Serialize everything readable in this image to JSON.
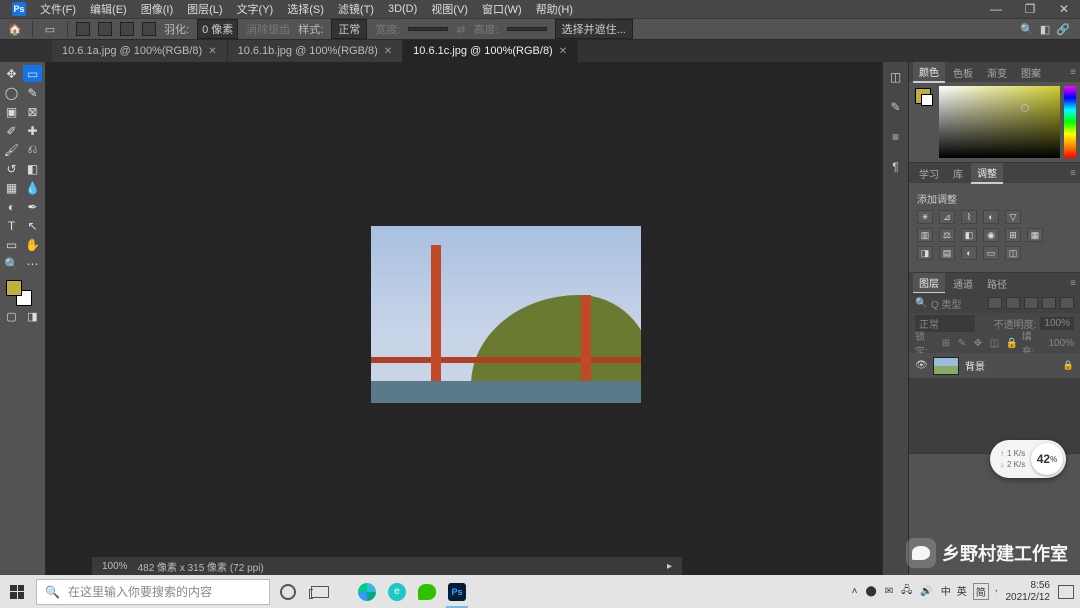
{
  "menubar": {
    "items": [
      "文件(F)",
      "编辑(E)",
      "图像(I)",
      "图层(L)",
      "文字(Y)",
      "选择(S)",
      "滤镜(T)",
      "3D(D)",
      "视图(V)",
      "窗口(W)",
      "帮助(H)"
    ]
  },
  "optbar": {
    "feather_label": "羽化:",
    "feather_value": "0 像素",
    "antialias": "消除锯齿",
    "style_label": "样式:",
    "style_value": "正常",
    "width_label": "宽度:",
    "height_label": "高度:",
    "select_mask": "选择并遮住..."
  },
  "tabs": [
    {
      "label": "10.6.1a.jpg @ 100%(RGB/8)",
      "active": false
    },
    {
      "label": "10.6.1b.jpg @ 100%(RGB/8)",
      "active": false
    },
    {
      "label": "10.6.1c.jpg @ 100%(RGB/8)",
      "active": true
    }
  ],
  "status": {
    "zoom": "100%",
    "info": "482 像素 x 315 像素 (72 ppi)"
  },
  "color_panel": {
    "tabs": [
      "颜色",
      "色板",
      "渐变",
      "图案"
    ],
    "active": "颜色"
  },
  "adj_panel": {
    "tabs": [
      "学习",
      "库",
      "调整"
    ],
    "active": "调整",
    "title": "添加调整"
  },
  "layers_panel": {
    "tabs": [
      "图层",
      "通道",
      "路径"
    ],
    "active": "图层",
    "kind": "Q 类型",
    "blend": "正常",
    "opacity_label": "不透明度:",
    "opacity": "100%",
    "lock_label": "锁定:",
    "fill_label": "填充:",
    "fill": "100%",
    "layer_name": "背景"
  },
  "pill": {
    "up": "1  K/s",
    "down": "2  K/s",
    "pct": "42"
  },
  "watermark": "乡野村建工作室",
  "taskbar": {
    "search_placeholder": "在这里输入你要搜索的内容",
    "ime1": "中",
    "ime2": "英",
    "ime3": "简",
    "time": "8:56",
    "date": "2021/2/12"
  }
}
